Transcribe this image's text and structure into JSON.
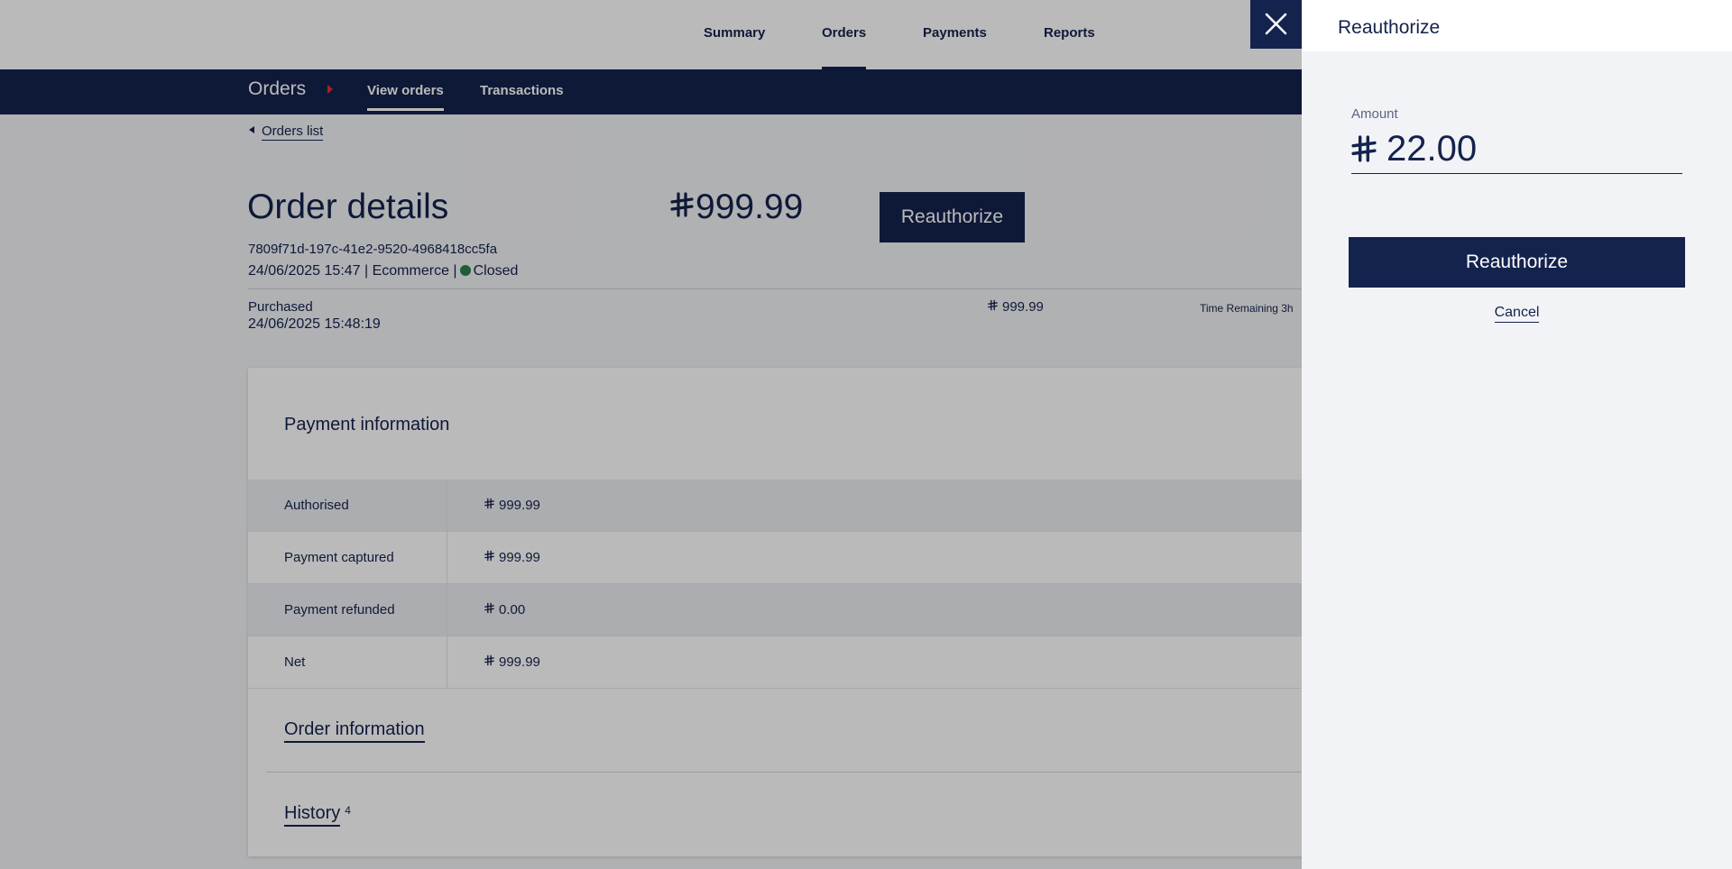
{
  "topnav": {
    "items": [
      {
        "label": "Summary",
        "active": false
      },
      {
        "label": "Orders",
        "active": true
      },
      {
        "label": "Payments",
        "active": false
      },
      {
        "label": "Reports",
        "active": false
      }
    ]
  },
  "subnav": {
    "section": "Orders",
    "items": [
      {
        "label": "View orders",
        "active": true
      },
      {
        "label": "Transactions",
        "active": false
      }
    ]
  },
  "back_link": "Orders list",
  "order": {
    "title": "Order details",
    "amount": "999.99",
    "reauthorize_label": "Reauthorize",
    "id": "7809f71d-197c-41e2-9520-4968418cc5fa",
    "datetime": "24/06/2025 15:47",
    "channel": "Ecommerce",
    "status": "Closed",
    "purchased_label": "Purchased",
    "purchased_date": "24/06/2025 15:48:19",
    "purchased_amount": "999.99",
    "time_remaining": "Time Remaining 3h"
  },
  "payment_info": {
    "title": "Payment information",
    "rows": [
      {
        "label": "Authorised",
        "value": "999.99"
      },
      {
        "label": "Payment captured",
        "value": "999.99"
      },
      {
        "label": "Payment refunded",
        "value": "0.00"
      },
      {
        "label": "Net",
        "value": "999.99"
      }
    ]
  },
  "order_information": "Order information",
  "history": {
    "label": "History",
    "count": "4"
  },
  "panel": {
    "title": "Reauthorize",
    "amount_label": "Amount",
    "amount_value": "22.00",
    "submit_label": "Reauthorize",
    "cancel_label": "Cancel"
  },
  "icons": {
    "currency": "currency-symbol-icon",
    "close": "close-icon",
    "back": "caret-left-icon",
    "status": "status-dot-icon"
  },
  "colors": {
    "brand": "#14234d",
    "accent_red": "#e2312e",
    "status_closed": "#2e7d4c",
    "page_bg": "#f2f3f6"
  }
}
